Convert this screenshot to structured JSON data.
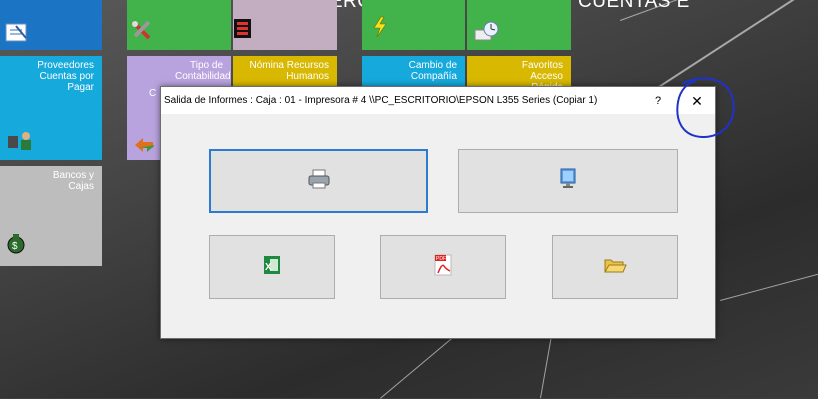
{
  "banner": {
    "text": "COMERCIAL Y FACTURACION, CUENTAS E"
  },
  "tiles": {
    "proveedores": "Proveedores Cuentas por Pagar",
    "contabilidad": "Tipo de Contabilidad",
    "contabilidad_partial": "C",
    "nomina": "Nómina Recursos Humanos",
    "cambio": "Cambio de Compañía",
    "favoritos": "Favoritos Acceso Rápido",
    "bancos": "Bancos y Cajas"
  },
  "dialog": {
    "title": "Salida de Informes :  Caja : 01 - Impresora #  4 \\\\PC_ESCRITORIO\\EPSON L355 Series (Copiar 1)",
    "help": "?",
    "close": "✕"
  },
  "buttons": {
    "printer_icon": "printer-icon",
    "screen_icon": "monitor-icon",
    "excel_icon": "excel-icon",
    "pdf_icon": "pdf-icon",
    "folder_icon": "folder-icon",
    "pdf_badge": "PDF"
  },
  "colors": {
    "tile_blue": "#1b74c4",
    "tile_green": "#41b34a",
    "tile_lavender": "#b9a3de",
    "tile_mauve": "#c3adc0",
    "tile_yellow": "#d8b800",
    "tile_cyan": "#16a9dc",
    "tile_gray": "#bdbdbd",
    "dialog_bg": "#f0f0f0",
    "focus_border": "#2c7bd0",
    "annotation_circle": "#2032c8"
  }
}
